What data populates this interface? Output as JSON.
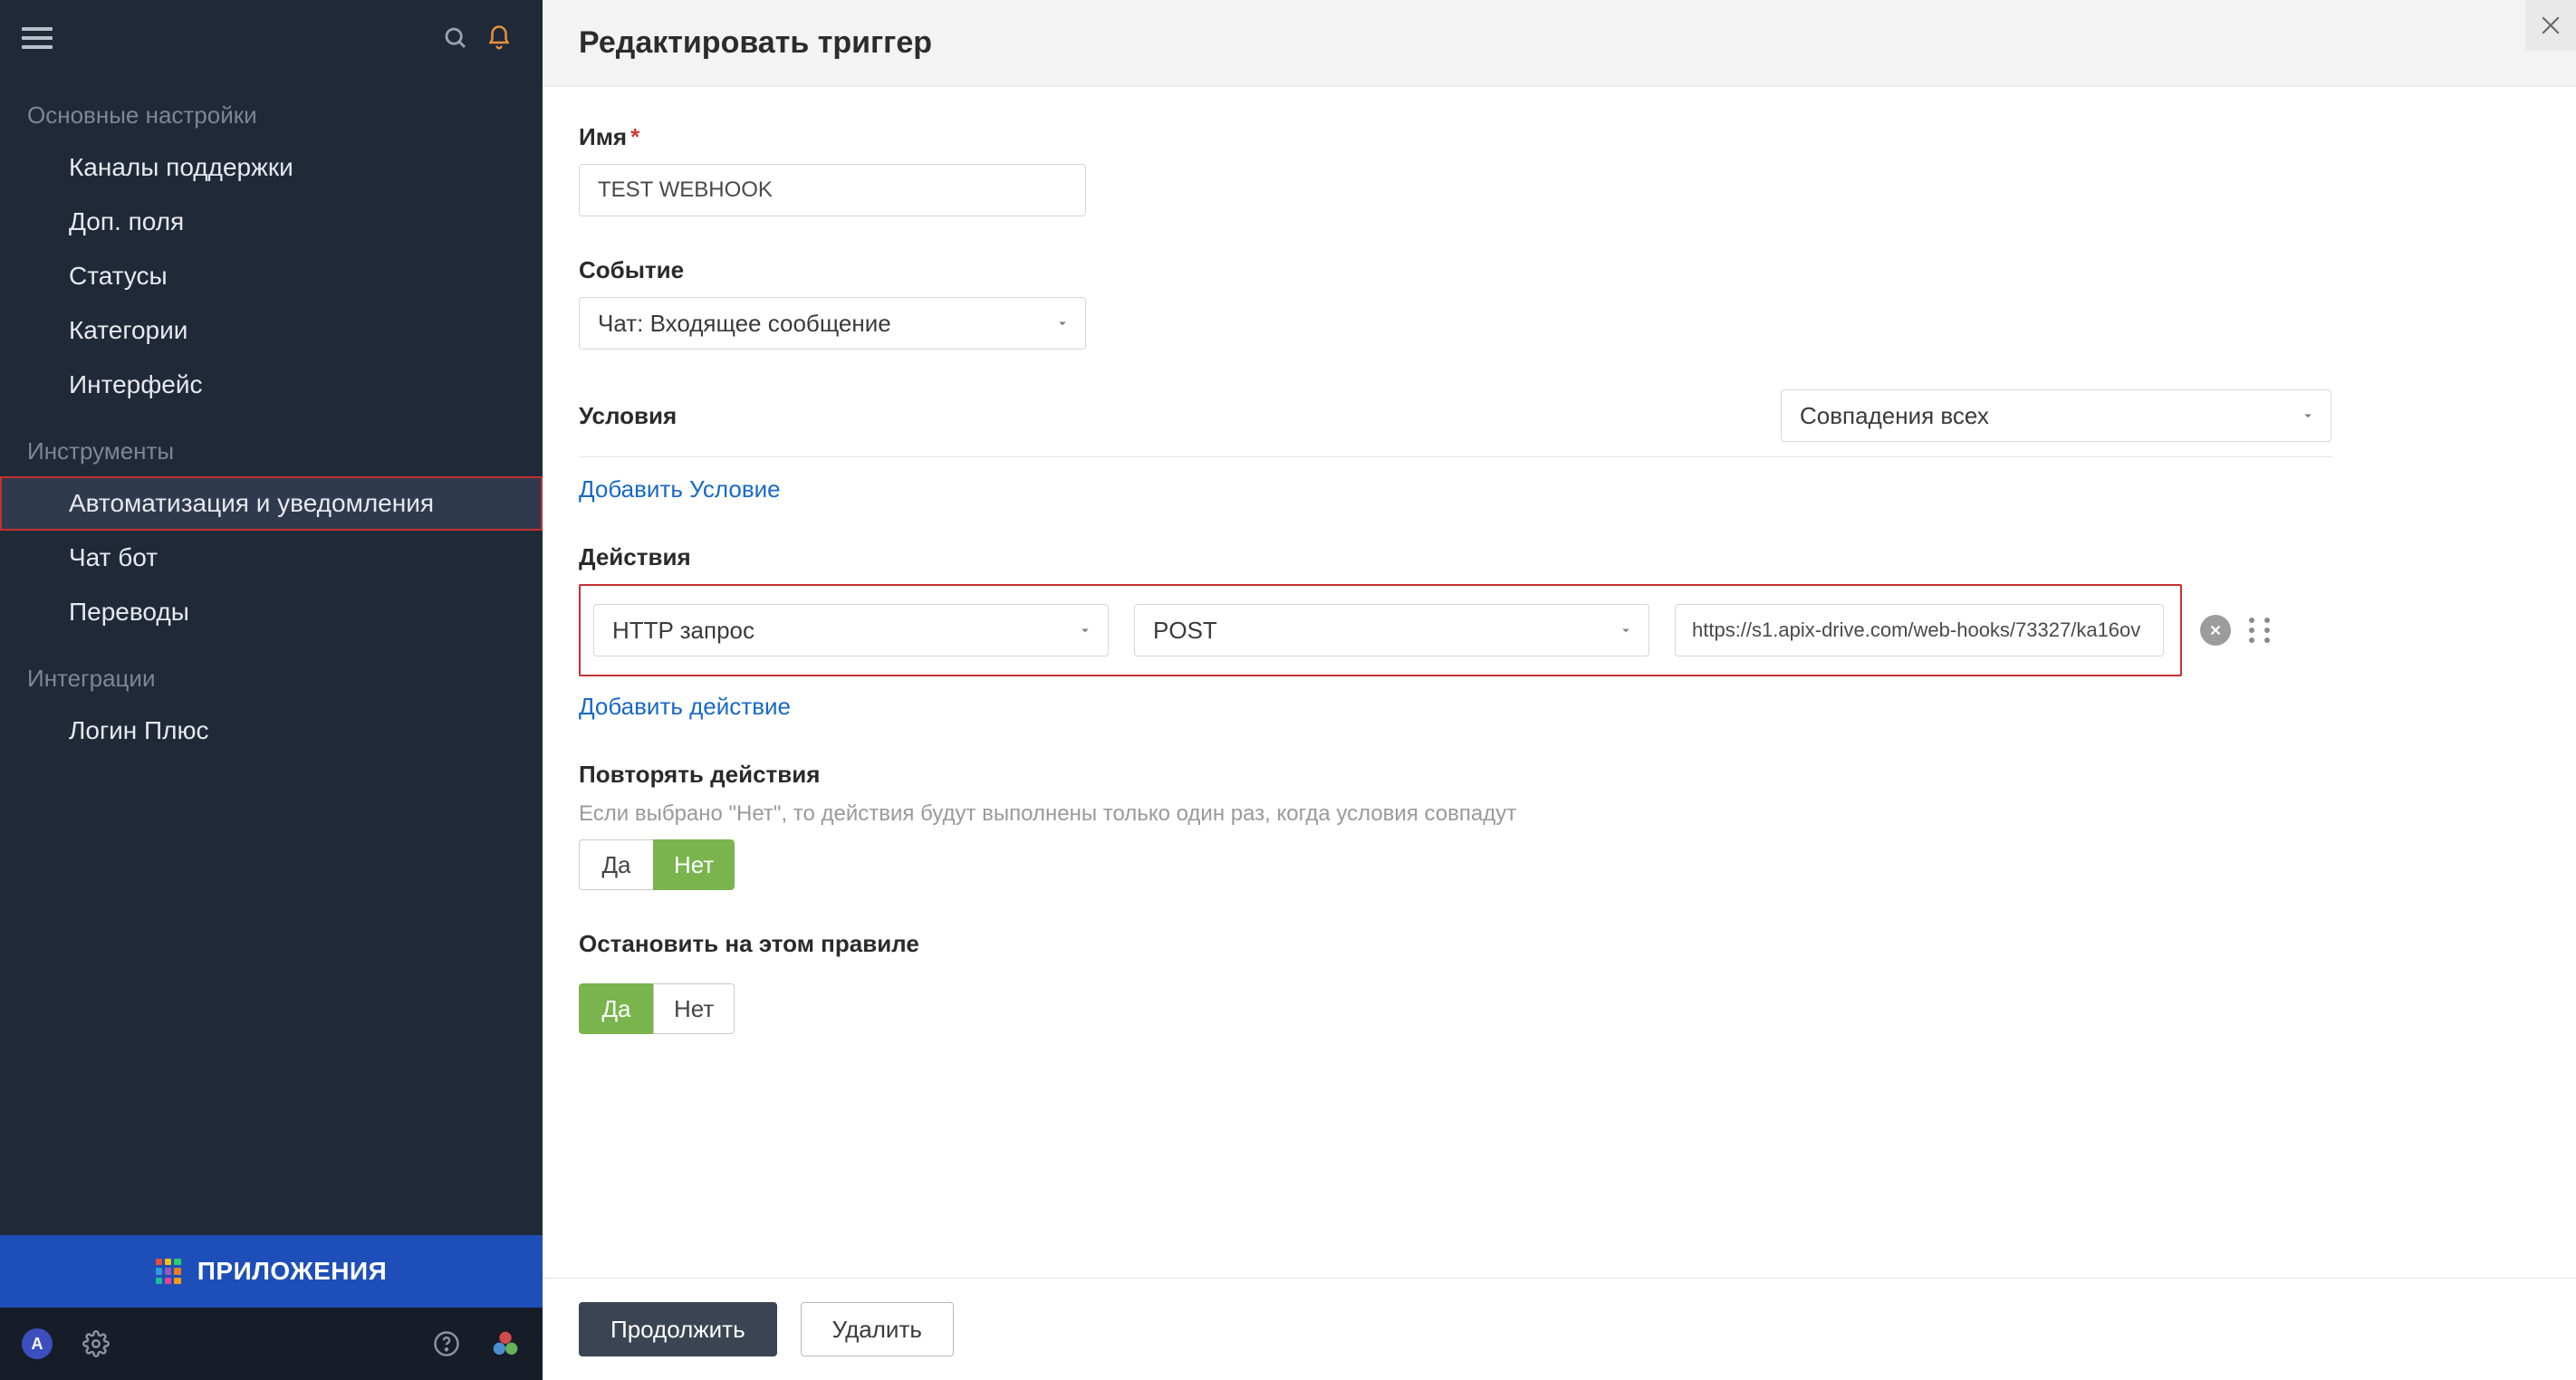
{
  "sidebar": {
    "sections": [
      {
        "title": "Основные настройки",
        "items": [
          {
            "label": "Каналы поддержки",
            "id": "channels"
          },
          {
            "label": "Доп. поля",
            "id": "fields"
          },
          {
            "label": "Статусы",
            "id": "statuses"
          },
          {
            "label": "Категории",
            "id": "categories"
          },
          {
            "label": "Интерфейс",
            "id": "interface"
          }
        ]
      },
      {
        "title": "Инструменты",
        "items": [
          {
            "label": "Автоматизация и уведомления",
            "id": "automation",
            "active": true
          },
          {
            "label": "Чат бот",
            "id": "chatbot"
          },
          {
            "label": "Переводы",
            "id": "translations"
          }
        ]
      },
      {
        "title": "Интеграции",
        "items": [
          {
            "label": "Логин Плюс",
            "id": "login-plus"
          }
        ]
      }
    ],
    "apps_label": "ПРИЛОЖЕНИЯ",
    "avatar_initial": "A"
  },
  "header": {
    "title": "Редактировать триггер"
  },
  "form": {
    "name_label": "Имя",
    "name_value": "TEST WEBHOOK",
    "event_label": "Событие",
    "event_value": "Чат: Входящее сообщение",
    "conditions_label": "Условия",
    "conditions_match_value": "Совпадения всех",
    "add_condition": "Добавить Условие",
    "actions_label": "Действия",
    "action_type": "HTTP запрос",
    "action_method": "POST",
    "action_url": "https://s1.apix-drive.com/web-hooks/73327/ka16ov",
    "add_action": "Добавить действие",
    "repeat_label": "Повторять действия",
    "repeat_help": "Если выбрано \"Нет\", то действия будут выполнены только один раз, когда условия совпадут",
    "yes": "Да",
    "no": "Нет",
    "stop_label": "Остановить на этом правиле"
  },
  "buttons": {
    "continue": "Продолжить",
    "delete": "Удалить"
  },
  "colors": {
    "apps_grid": [
      "#e74c3c",
      "#f1c40f",
      "#2ecc71",
      "#3498db",
      "#9b59b6",
      "#e67e22",
      "#1abc9c",
      "#e84393",
      "#f39c12"
    ]
  }
}
